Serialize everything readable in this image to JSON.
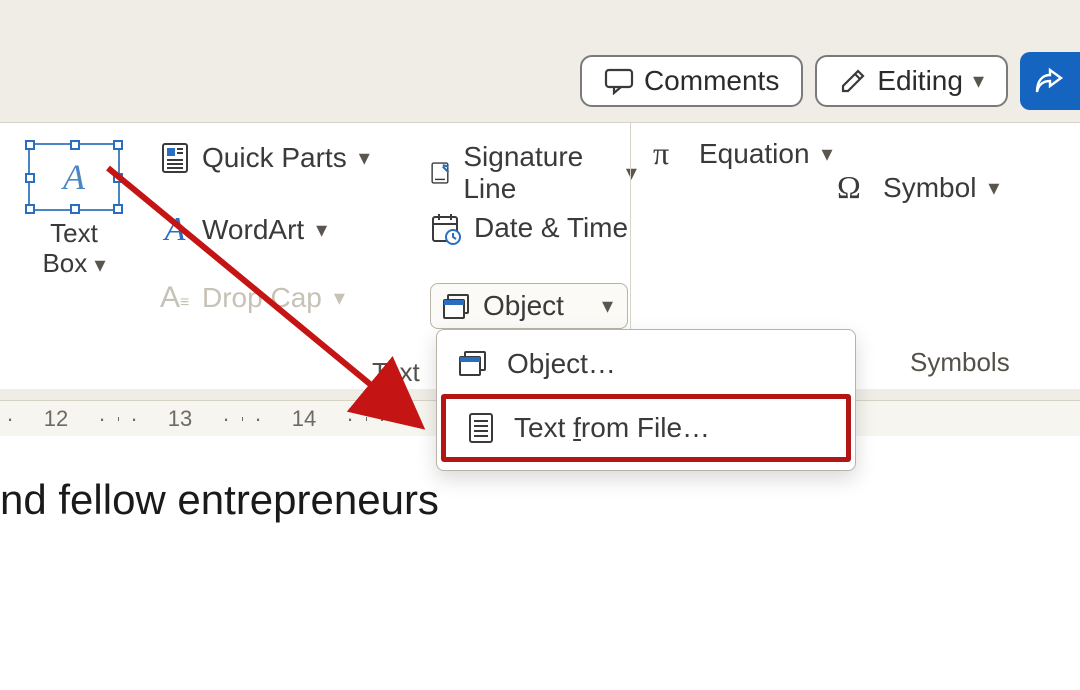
{
  "topbar": {
    "comments": "Comments",
    "editing": "Editing"
  },
  "ribbon": {
    "textBox": "Text\nBox",
    "quickParts": "Quick Parts",
    "wordArt": "WordArt",
    "dropCap": "Drop Cap",
    "signatureLine": "Signature Line",
    "dateTime": "Date & Time",
    "object": "Object",
    "groupTextLabel": "Text",
    "equation": "Equation",
    "symbol": "Symbol",
    "groupSymbolsLabel": "Symbols"
  },
  "dropdown": {
    "objectItem": "Object…",
    "textFromFilePre": "Text ",
    "textFromFileKey": "f",
    "textFromFilePost": "rom File…"
  },
  "ruler": {
    "marks": [
      "12",
      "13",
      "14"
    ]
  },
  "document": {
    "visibleText": "nd fellow entrepreneurs"
  }
}
